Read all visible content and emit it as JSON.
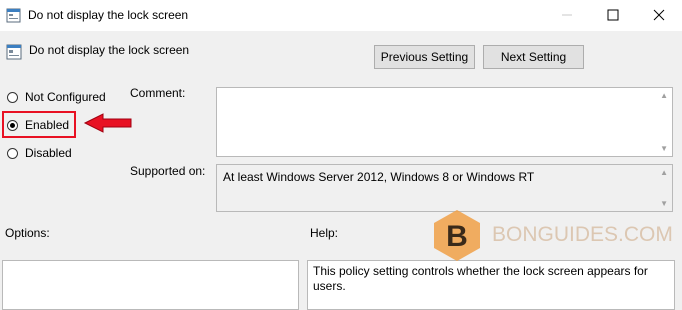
{
  "window": {
    "title": "Do not display the lock screen"
  },
  "header": {
    "title": "Do not display the lock screen"
  },
  "nav": {
    "prev_label": "Previous Setting",
    "next_label": "Next Setting"
  },
  "state": {
    "options": [
      "Not Configured",
      "Enabled",
      "Disabled"
    ],
    "selected": "Enabled"
  },
  "comment": {
    "label": "Comment:",
    "value": ""
  },
  "supported": {
    "label": "Supported on:",
    "value": "At least Windows Server 2012, Windows 8 or Windows RT"
  },
  "options_panel": {
    "label": "Options:"
  },
  "help_panel": {
    "label": "Help:",
    "text": "This policy setting controls whether the lock screen appears for users."
  },
  "watermark": {
    "text": "BONGUIDES.COM",
    "logo_letter": "B"
  },
  "colors": {
    "highlight": "#e81123",
    "watermark": "#dcc7b2",
    "logo": "#f0a046"
  }
}
